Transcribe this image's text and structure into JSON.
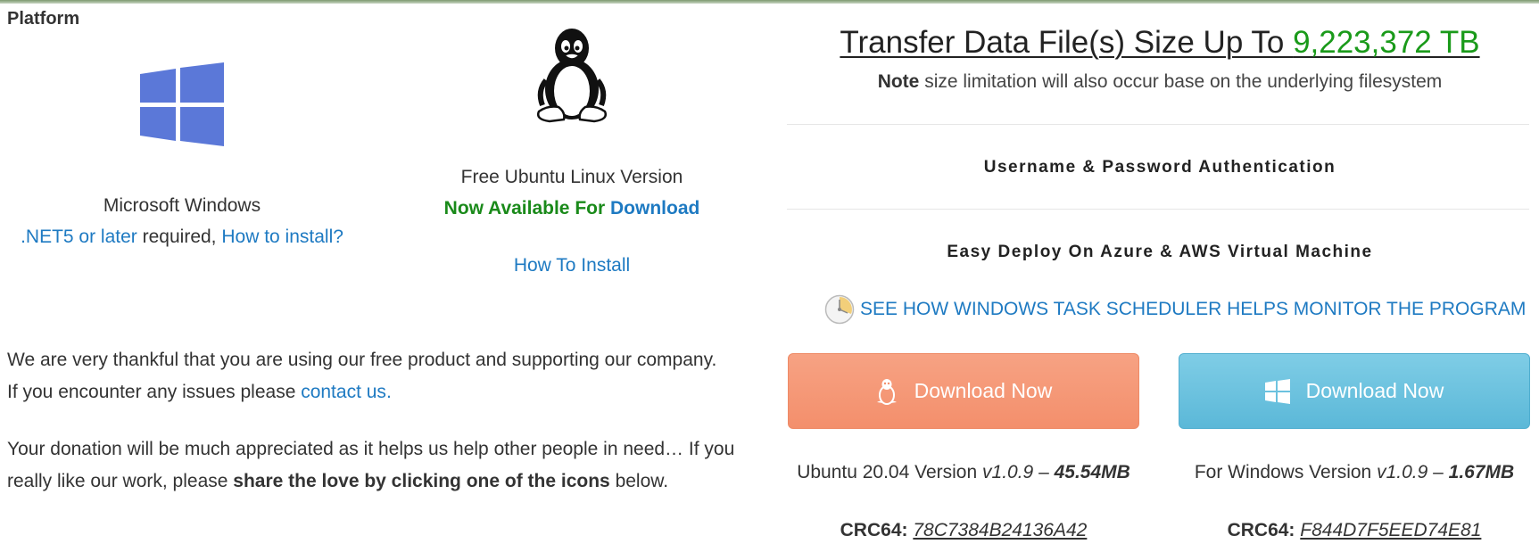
{
  "platform": {
    "label": "Platform"
  },
  "windows": {
    "title": "Microsoft Windows",
    "req_link": ".NET5 or later",
    "req_text": " required, ",
    "install_link": "How to install?"
  },
  "linux": {
    "title": "Free Ubuntu Linux Version",
    "available_text": "Now Available For ",
    "download_link": "Download",
    "how_to_install": "How To Install"
  },
  "thanks": {
    "line1": "We are very thankful that you are using our free product and supporting our company.",
    "line2_prefix": "If you encounter any issues please ",
    "contact_link": "contact us",
    "line2_suffix": ".",
    "donation_prefix": "Your donation will be much appreciated as it helps us help other people in need… If you really like our work, please ",
    "donation_bold": "share the love by clicking one of the icons",
    "donation_suffix": " below."
  },
  "transfer": {
    "title_prefix": "Transfer Data File(s) Size Up To ",
    "title_value": "9,223,372 TB",
    "note_bold": "Note",
    "note_text": " size limitation will also occur base on the underlying filesystem"
  },
  "features": {
    "auth": "Username & Password Authentication",
    "deploy": "Easy Deploy On Azure & AWS Virtual Machine"
  },
  "scheduler": {
    "link": "SEE HOW WINDOWS TASK SCHEDULER HELPS MONITOR THE PROGRAM"
  },
  "downloads": {
    "linux": {
      "button": "Download Now",
      "version_prefix": "Ubuntu 20.04 Version ",
      "version": "v1.0.9",
      "dash": " – ",
      "size": "45.54MB",
      "crc_label": "CRC64:",
      "crc": "78C7384B24136A42"
    },
    "windows": {
      "button": "Download Now",
      "version_prefix": "For Windows Version ",
      "version": "v1.0.9",
      "dash": " – ",
      "size": "1.67MB",
      "crc_label": "CRC64:",
      "crc": "F844D7F5EED74E81"
    }
  },
  "colors": {
    "link": "#1e7ac2",
    "green": "#1a9a1a",
    "linux_button": "#f49a79",
    "windows_button": "#6cc2e0",
    "windows_logo": "#5b78d8"
  },
  "icons": {
    "windows_logo": "windows-logo-icon",
    "tux": "tux-penguin-icon",
    "clock": "clock-icon"
  }
}
